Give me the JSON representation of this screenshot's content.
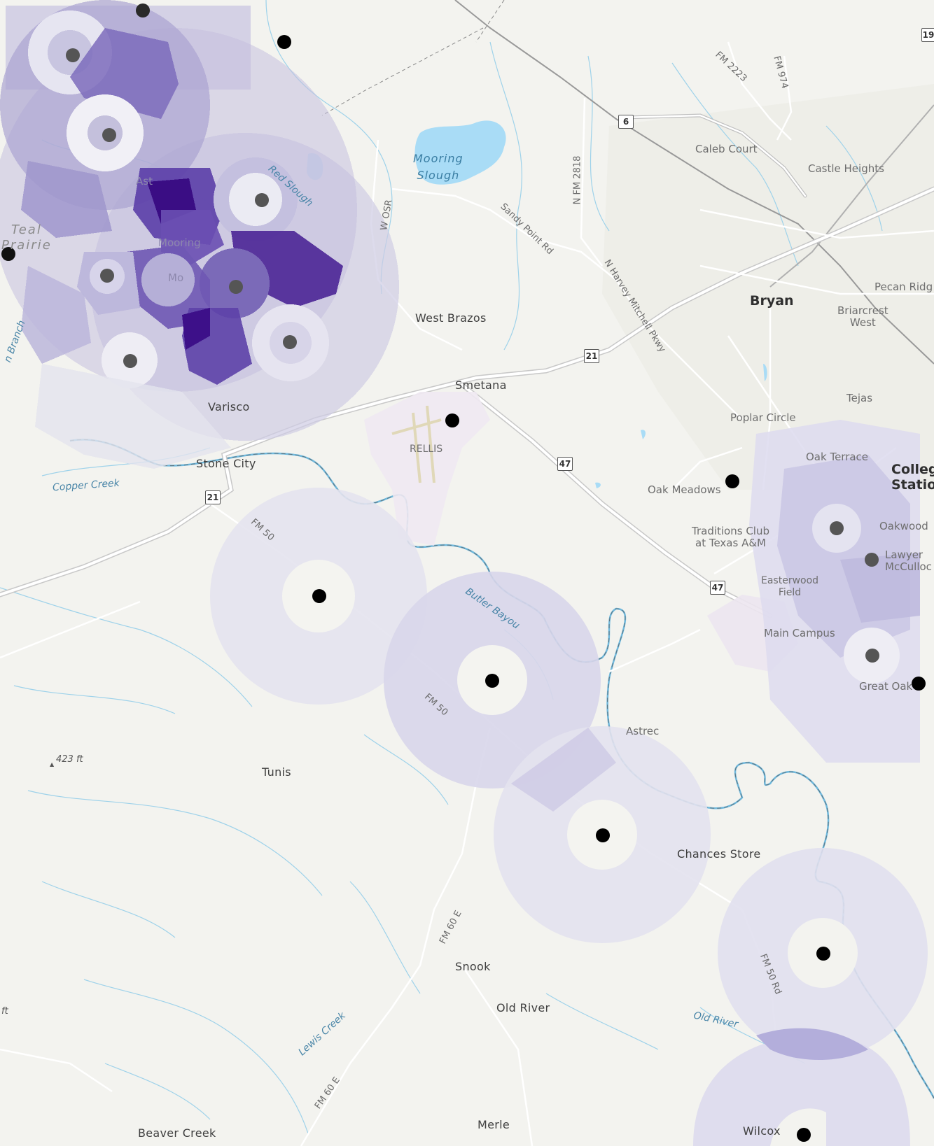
{
  "map": {
    "place_labels": {
      "bryan": "Bryan",
      "west_brazos": "West Brazos",
      "smetana": "Smetana",
      "caleb_court": "Caleb Court",
      "castle_heights": "Castle Heights",
      "pecan_ridge": "Pecan Ridg",
      "briarcrest_west": "Briarcrest\nWest",
      "tejas": "Tejas",
      "poplar_circle": "Poplar Circle",
      "oak_terrace": "Oak Terrace",
      "college_station": "Colleg\nStatio",
      "oak_meadows": "Oak Meadows",
      "oakwood": "Oakwood",
      "lawyer_mcculloch": "Lawyer\nMcCulloc",
      "traditions_club": "Traditions Club\nat Texas A&M",
      "easterwood_field": "Easterwood\nField",
      "main_campus": "Main Campus",
      "great_oaks": "Great Oak",
      "varisco": "Varisco",
      "stone_city": "Stone City",
      "rellis": "RELLIS",
      "teal_prairie": "Teal\nPrairie",
      "astrec": "Astrec",
      "tunis": "Tunis",
      "chances_store": "Chances Store",
      "snook": "Snook",
      "old_river_place": "Old River",
      "beaver_creek": "Beaver Creek",
      "merle": "Merle",
      "wilcox": "Wilcox",
      "ast_partial": "Ast",
      "mooring_partial": "Mooring",
      "mo_partial": "Mo"
    },
    "road_labels": {
      "fm2223": "FM 2223",
      "fm974": "FM 974",
      "n_fm2818": "N FM 2818",
      "w_osr": "W OSR",
      "sandy_point": "Sandy Point Rd",
      "n_harvey_mitchell": "N Harvey Mitchell Pkwy",
      "fm50_a": "FM 50",
      "fm50_b": "FM 50",
      "fm50_rd": "FM 50 Rd",
      "fm60e_a": "FM 60 E",
      "fm60e_b": "FM 60 E"
    },
    "water_labels": {
      "mooring_slough": "Mooring\nSlough",
      "red_slough": "Red Slough",
      "copper_creek": "Copper Creek",
      "butler_bayou": "Butler Bayou",
      "old_river": "Old River",
      "lewis_creek": "Lewis Creek",
      "branch": "n Branch"
    },
    "shields": {
      "s6": "6",
      "s21a": "21",
      "s21b": "21",
      "s47a": "47",
      "s47b": "47",
      "s19": "19"
    },
    "elevations": {
      "e423": "423 ft",
      "eft": "ft"
    },
    "colors": {
      "background": "#f3f3ef",
      "water": "#a9dcf6",
      "river": "#6fb8dc",
      "road": "#ffffff",
      "highway_casing": "#b0b0b0",
      "density_light": "#dcdcec",
      "density_mid": "#9a8fc7",
      "density_dark": "#3a0d84",
      "point": "#000000"
    }
  }
}
